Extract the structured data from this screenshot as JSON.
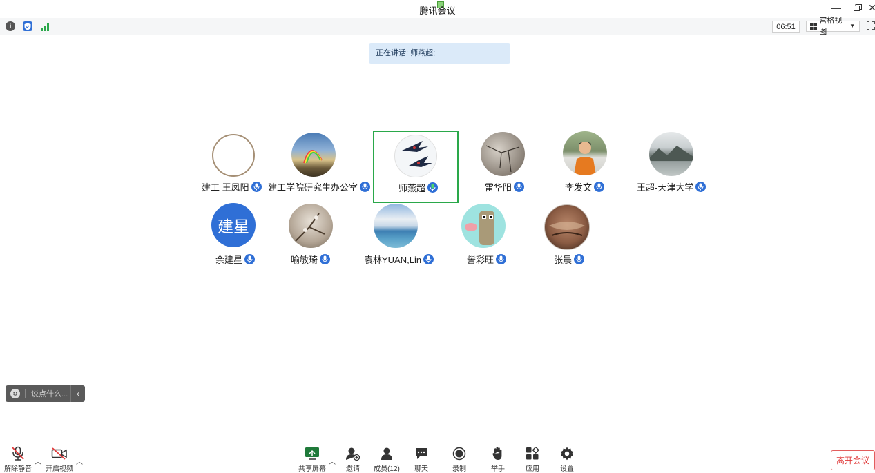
{
  "window": {
    "title": "腾讯会议",
    "minimize_icon": "minimize-icon",
    "restore_icon": "restore-icon",
    "close_icon": "close-icon"
  },
  "infobar": {
    "icons": [
      "info-icon",
      "shield-icon",
      "signal-icon"
    ],
    "timer": "06:51",
    "view_label": "宫格视图"
  },
  "speaking": {
    "text": "正在讲话: 师燕超;"
  },
  "participants": [
    {
      "name": "建工 王凤阳",
      "avatar": "empty-ring"
    },
    {
      "name": "建工学院研究生办公室",
      "avatar": "rainbow-landscape"
    },
    {
      "name": "师燕超",
      "avatar": "swallows",
      "speaking": true
    },
    {
      "name": "雷华阳",
      "avatar": "cracked-ground"
    },
    {
      "name": "李发文",
      "avatar": "person-photo"
    },
    {
      "name": "王超-天津大学",
      "avatar": "lake-mountains"
    },
    {
      "name": "余建星",
      "avatar": "initials",
      "initials": "建星",
      "color": "#2f6fd6"
    },
    {
      "name": "喻敏琦",
      "avatar": "blossom-branch"
    },
    {
      "name": "袁林YUAN,Lin",
      "avatar": "sea-sky"
    },
    {
      "name": "訾彩旺",
      "avatar": "pixel-cartoon"
    },
    {
      "name": "张晨",
      "avatar": "canyon"
    }
  ],
  "chat": {
    "placeholder": "说点什么..."
  },
  "toolbar": {
    "unmute": "解除静音",
    "start_video": "开启视频",
    "share_screen": "共享屏幕",
    "invite": "邀请",
    "members": "成员(12)",
    "chat": "聊天",
    "record": "录制",
    "raise_hand": "举手",
    "apps": "应用",
    "settings": "设置",
    "leave": "离开会议"
  },
  "colors": {
    "accent": "#2f6fd6",
    "active_border": "#2aa84a",
    "leave": "#e03b3b",
    "speaking_bg": "#dbeaf9"
  }
}
